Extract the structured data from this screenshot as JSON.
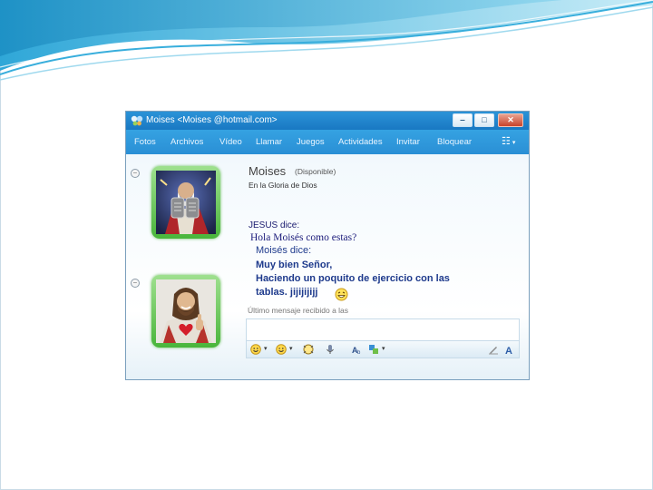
{
  "window": {
    "title": "Moises <Moises @hotmail.com>",
    "controls": [
      "‒",
      "□",
      "✕"
    ]
  },
  "menu": [
    "Fotos",
    "Archivos",
    "Vídeo",
    "Llamar",
    "Juegos",
    "Actividades",
    "Invitar",
    "Bloquear"
  ],
  "contact": {
    "name": "Moises",
    "status": "(Disponible)",
    "personal_message": "En la Gloria de Dios"
  },
  "conversation": {
    "line1": "JESUS dice:",
    "line2": "Hola Moisés como estas?",
    "line3": "Moisés dice:",
    "line4": "Muy bien Señor,",
    "line5": "Haciendo un poquito de ejercicio con las",
    "line6": "tablas. jijijijijj"
  },
  "last_message": "Último mensaje recibido a las",
  "icons": {
    "title": "msn-butterfly-icon",
    "menu_right": "menu-options-icon",
    "laugh": "laughing-emoticon-icon"
  },
  "colors": {
    "titlebar": "#1e84cc",
    "menubar": "#2f98dc",
    "avatar_border": "#5cc24c",
    "message_text": "#1e3a8c"
  }
}
